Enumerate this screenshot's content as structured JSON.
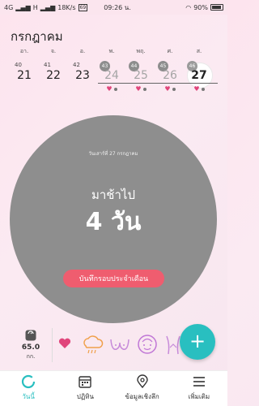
{
  "status_bar": {
    "network": "4G",
    "signal_h": "H",
    "speed": "18K/s",
    "badge": "69",
    "time": "09:26 น.",
    "battery": "90%"
  },
  "calendar": {
    "month_title": "กรกฎาคม",
    "days": [
      {
        "weekday": "อา.",
        "week": "40",
        "date": "21"
      },
      {
        "weekday": "จ.",
        "week": "41",
        "date": "22"
      },
      {
        "weekday": "อ.",
        "week": "42",
        "date": "23"
      },
      {
        "weekday": "พ.",
        "week": "43",
        "date": "24"
      },
      {
        "weekday": "พฤ.",
        "week": "44",
        "date": "25"
      },
      {
        "weekday": "ศ.",
        "week": "45",
        "date": "26"
      },
      {
        "weekday": "ส.",
        "week": "46",
        "date": "27"
      }
    ]
  },
  "main": {
    "date_label": "วันเสาร์ที่ 27 กรกฎาคม",
    "late_label": "มาช้าไป",
    "late_value": "4 วัน",
    "log_button": "บันทึกรอบประจำเดือน"
  },
  "weight": {
    "value": "65.0",
    "unit": "กก."
  },
  "colors": {
    "accent": "#29bfc0",
    "button": "#ef5d6f",
    "heart": "#e0457b",
    "circle": "#8e8e8e"
  },
  "nav": {
    "today": "วันนี้",
    "calendar": "ปฏิทิน",
    "insights": "ข้อมูลเชิงลึก",
    "more": "เพิ่มเติม"
  }
}
